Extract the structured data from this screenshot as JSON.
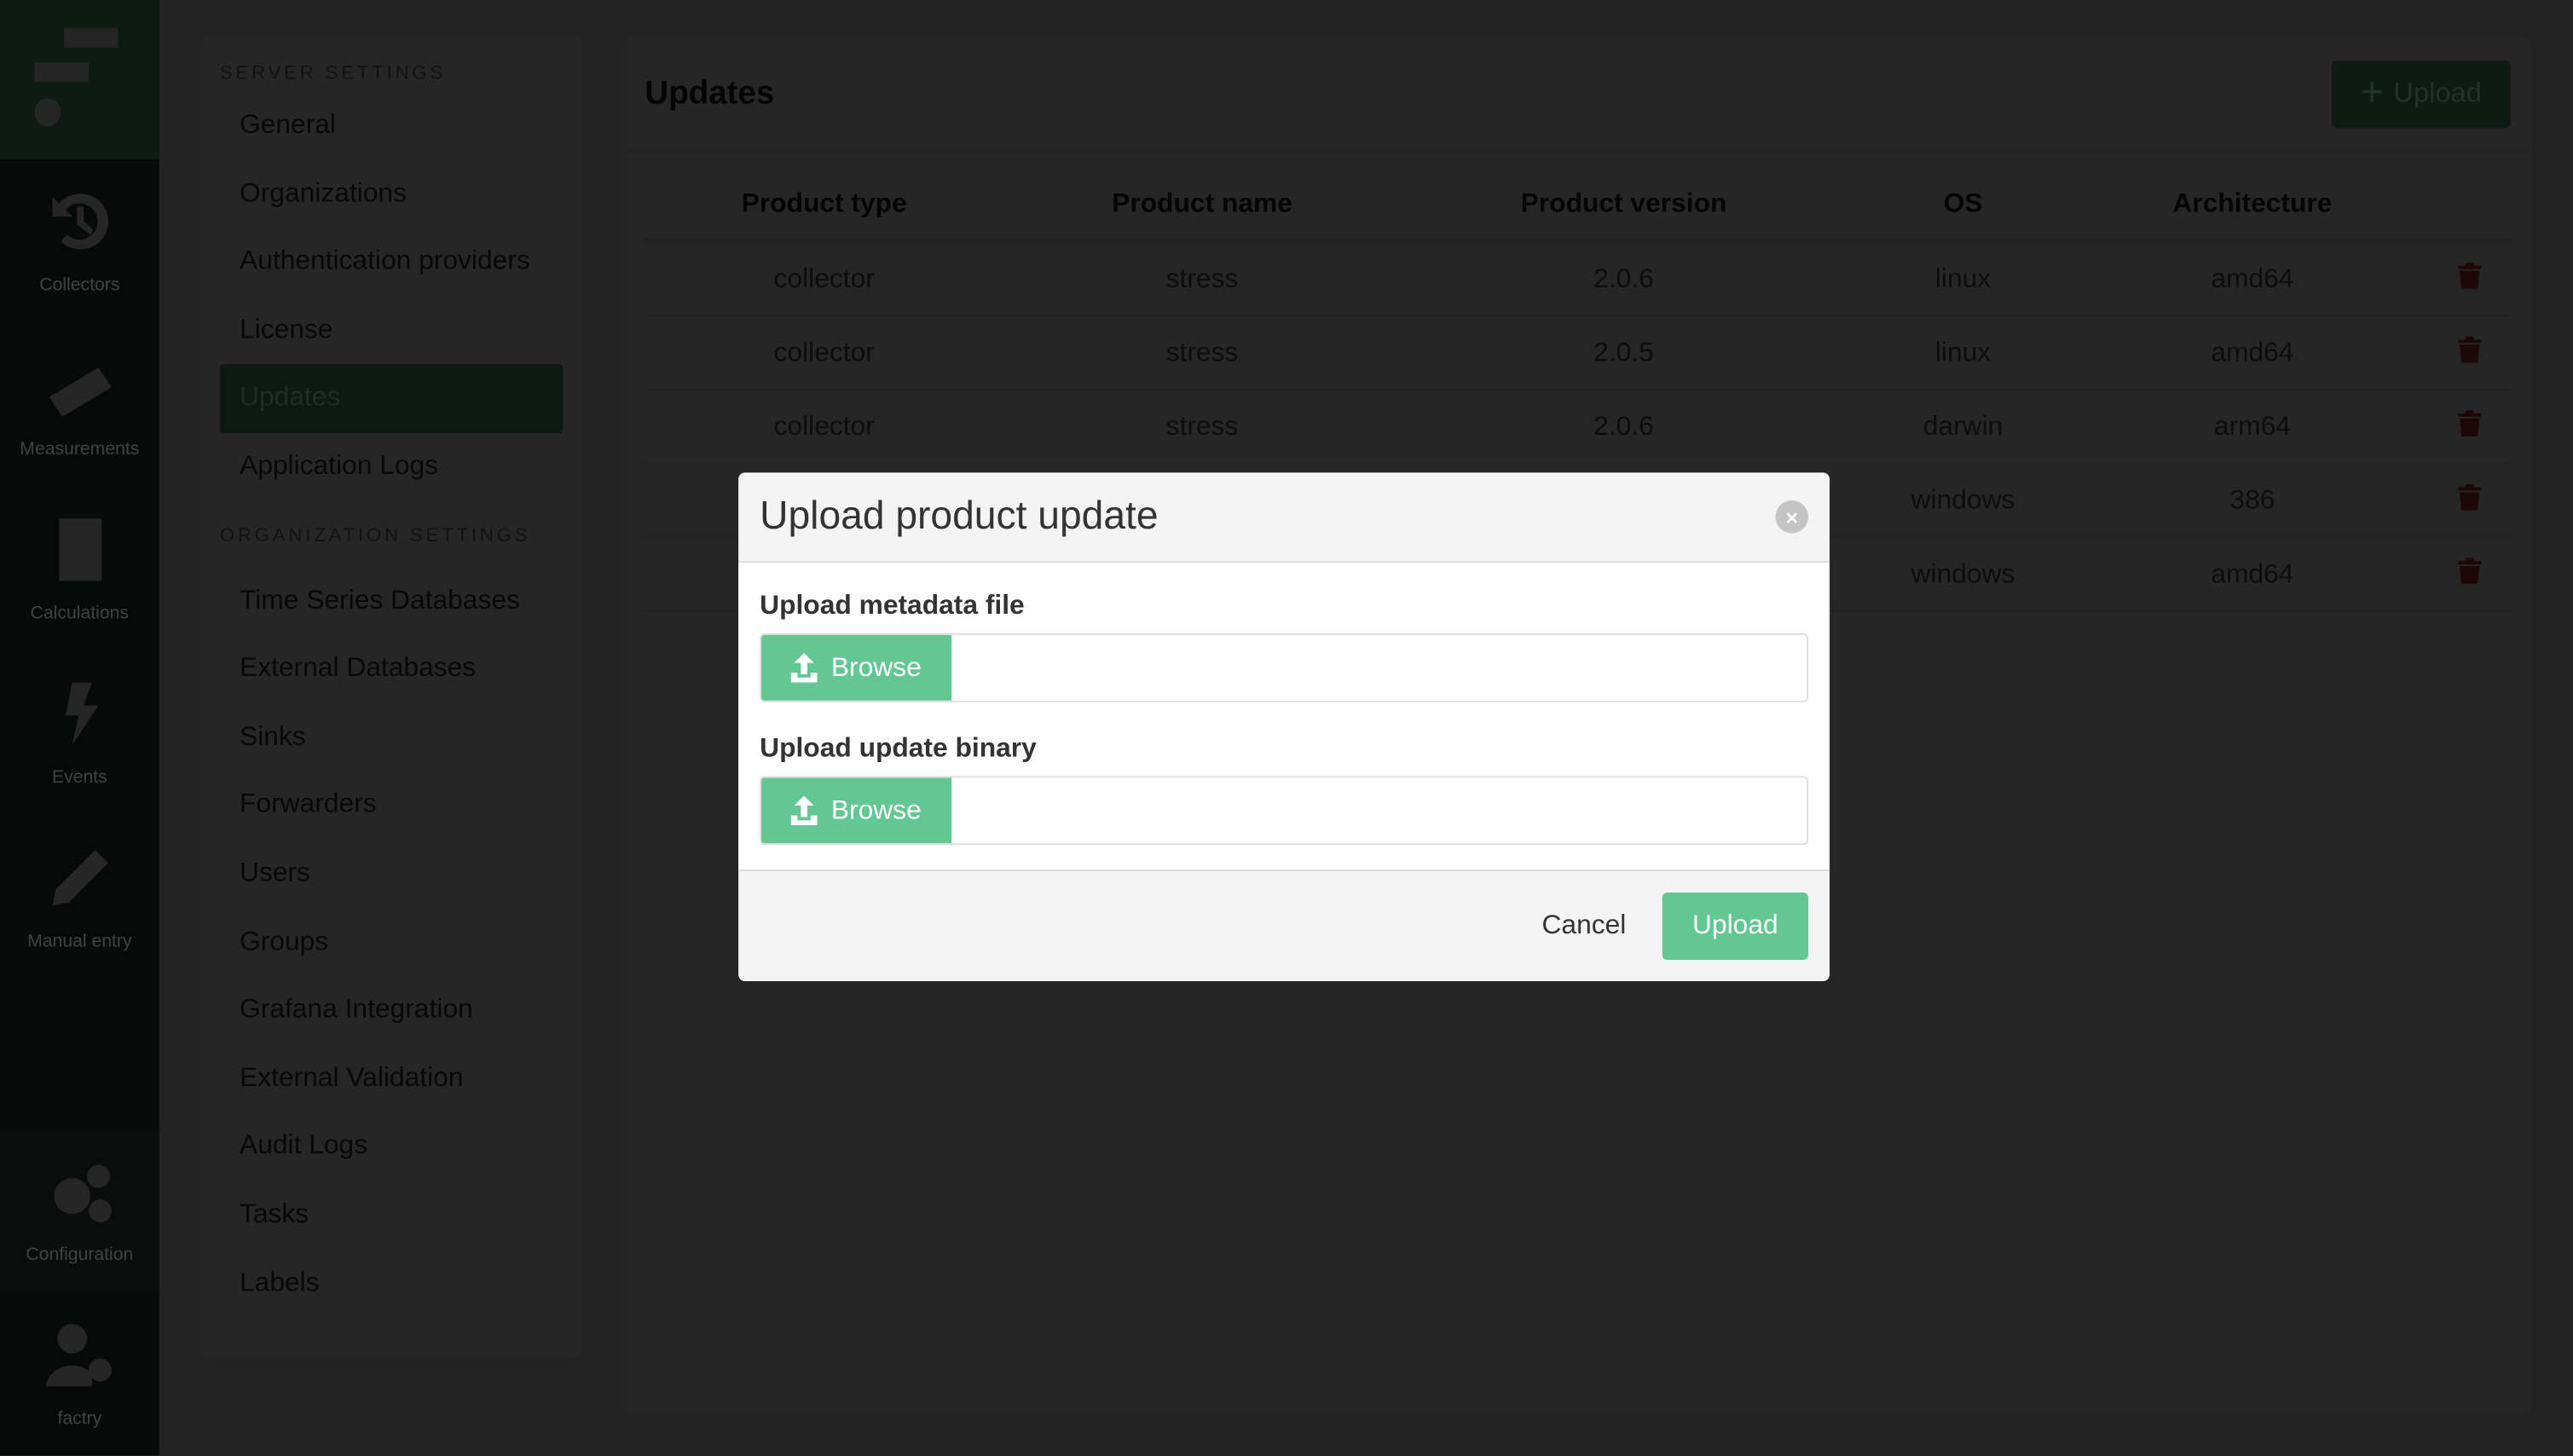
{
  "nav": {
    "items": [
      {
        "label": "Collectors",
        "icon": "history-icon"
      },
      {
        "label": "Measurements",
        "icon": "ruler-icon"
      },
      {
        "label": "Calculations",
        "icon": "calculator-icon"
      },
      {
        "label": "Events",
        "icon": "bolt-icon"
      },
      {
        "label": "Manual entry",
        "icon": "pencil-icon"
      },
      {
        "label": "Configuration",
        "icon": "gears-icon",
        "active": true
      },
      {
        "label": "factry",
        "icon": "user-gear-icon"
      }
    ]
  },
  "settings": {
    "server_title": "SERVER SETTINGS",
    "server_items": [
      "General",
      "Organizations",
      "Authentication providers",
      "License",
      "Updates",
      "Application Logs"
    ],
    "org_title": "ORGANIZATION SETTINGS",
    "org_items": [
      "Time Series Databases",
      "External Databases",
      "Sinks",
      "Forwarders",
      "Users",
      "Groups",
      "Grafana Integration",
      "External Validation",
      "Audit Logs",
      "Tasks",
      "Labels"
    ],
    "active": "Updates"
  },
  "main": {
    "title": "Updates",
    "upload_label": "Upload",
    "columns": [
      "Product type",
      "Product name",
      "Product version",
      "OS",
      "Architecture"
    ],
    "rows": [
      [
        "collector",
        "stress",
        "2.0.6",
        "linux",
        "amd64"
      ],
      [
        "collector",
        "stress",
        "2.0.5",
        "linux",
        "amd64"
      ],
      [
        "collector",
        "stress",
        "2.0.6",
        "darwin",
        "arm64"
      ],
      [
        "",
        "",
        "",
        "windows",
        "386"
      ],
      [
        "",
        "",
        "",
        "windows",
        "amd64"
      ]
    ]
  },
  "modal": {
    "title": "Upload product update",
    "metadata_label": "Upload metadata file",
    "binary_label": "Upload update binary",
    "browse_label": "Browse",
    "cancel_label": "Cancel",
    "upload_label": "Upload",
    "close_glyph": "×"
  },
  "colors": {
    "brand": "#2f9e5e",
    "modal_button": "#63c794",
    "delete": "#c0392b"
  }
}
